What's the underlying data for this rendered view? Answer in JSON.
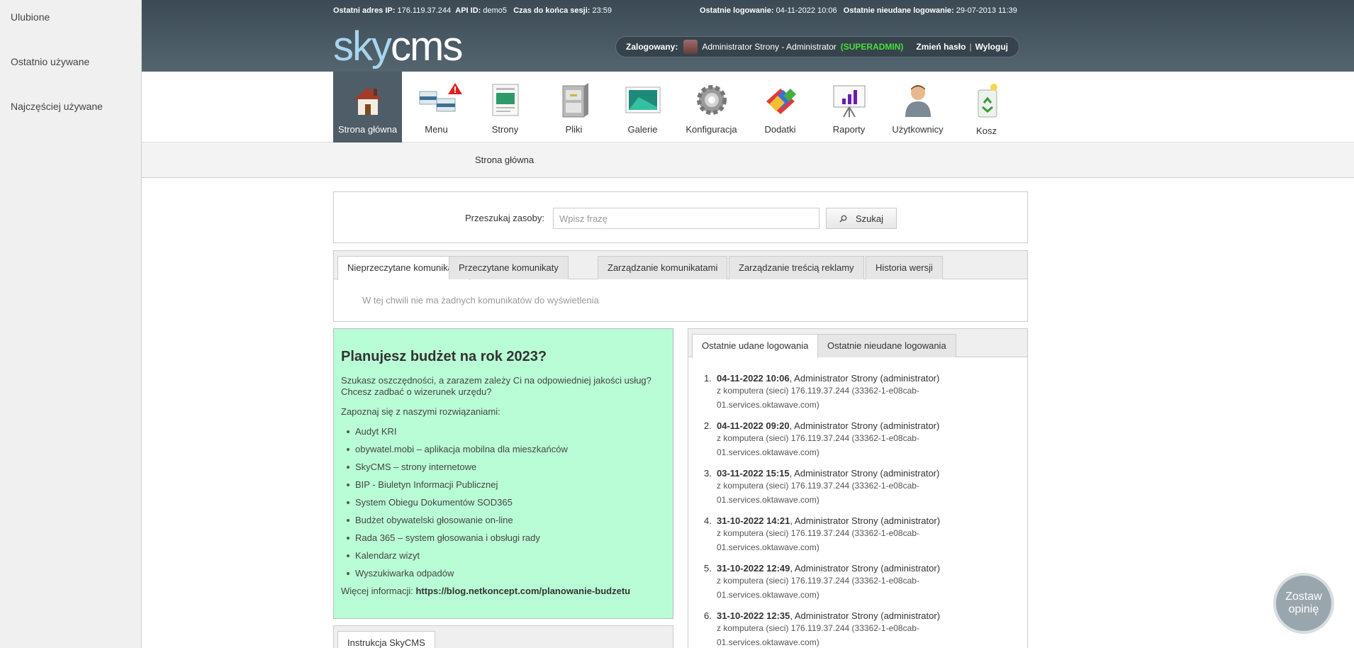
{
  "sidebar": {
    "items": [
      {
        "label": "Ulubione"
      },
      {
        "label": "Ostatnio używane"
      },
      {
        "label": "Najczęściej używane"
      }
    ]
  },
  "info": {
    "ip_label": "Ostatni adres IP:",
    "ip": "176.119.37.244",
    "api_label": "API ID:",
    "api": "demo5",
    "session_label": "Czas do końca sesji:",
    "session": "23:59",
    "last_login_label": "Ostatnie logowanie:",
    "last_login": "04-11-2022 10:06",
    "last_failed_label": "Ostatnie nieudane logowanie:",
    "last_failed": "29-07-2013 11:39"
  },
  "logo": {
    "sky": "sky",
    "cms": "cms"
  },
  "user": {
    "logged_label": "Zalogowany:",
    "name": "Administrator Strony",
    "role_text": "- Administrator",
    "role_badge": "(SUPERADMIN)",
    "change_password": "Zmień hasło",
    "logout": "Wyloguj"
  },
  "nav": [
    {
      "label": "Strona główna",
      "icon": "home-icon"
    },
    {
      "label": "Menu",
      "icon": "menu-icon"
    },
    {
      "label": "Strony",
      "icon": "pages-icon"
    },
    {
      "label": "Pliki",
      "icon": "files-icon"
    },
    {
      "label": "Galerie",
      "icon": "gallery-icon"
    },
    {
      "label": "Konfiguracja",
      "icon": "gear-icon"
    },
    {
      "label": "Dodatki",
      "icon": "addons-icon"
    },
    {
      "label": "Raporty",
      "icon": "reports-icon"
    },
    {
      "label": "Użytkownicy",
      "icon": "user-icon"
    },
    {
      "label": "Kosz",
      "icon": "trash-icon"
    }
  ],
  "breadcrumb": "Strona główna",
  "search": {
    "label": "Przeszukaj zasoby:",
    "placeholder": "Wpisz frazę",
    "button": "Szukaj"
  },
  "messages": {
    "tabs": [
      "Nieprzeczytane komunikaty",
      "Przeczytane komunikaty",
      "Zarządzanie komunikatami",
      "Zarządzanie treścią reklamy",
      "Historia wersji"
    ],
    "empty": "W tej chwili nie ma żadnych komunikatów do wyświetlenia"
  },
  "promo": {
    "title": "Planujesz budżet na rok 2023?",
    "p1": "Szukasz oszczędności, a zarazem zależy Ci na odpowiedniej jakości usług? Chcesz zadbać o wizerunek urzędu?",
    "p2": "Zapoznaj się z naszymi rozwiązaniami:",
    "items": [
      "Audyt KRI",
      "obywatel.mobi – aplikacja mobilna dla mieszkańców",
      "SkyCMS – strony internetowe",
      "BIP - Biuletyn Informacji Publicznej",
      "System Obiegu Dokumentów SOD365",
      "Budżet obywatelski głosowanie on-line",
      "Rada 365 – system głosowania i obsługi rady",
      "Kalendarz wizyt",
      "Wyszukiwarka odpadów"
    ],
    "more_label": "Więcej informacji:",
    "more_link": "https://blog.netkoncept.com/planowanie-budzetu"
  },
  "instr_tab": "Instrukcja SkyCMS",
  "logins": {
    "tabs": [
      "Ostatnie udane logowania",
      "Ostatnie nieudane logowania"
    ],
    "items": [
      {
        "num": "1.",
        "ts": "04-11-2022 10:06",
        "who": ", Administrator Strony (administrator)",
        "sub": "z komputera (sieci) 176.119.37.244 (33362-1-e08cab-01.services.oktawave.com)"
      },
      {
        "num": "2.",
        "ts": "04-11-2022 09:20",
        "who": ", Administrator Strony (administrator)",
        "sub": "z komputera (sieci) 176.119.37.244 (33362-1-e08cab-01.services.oktawave.com)"
      },
      {
        "num": "3.",
        "ts": "03-11-2022 15:15",
        "who": ", Administrator Strony (administrator)",
        "sub": "z komputera (sieci) 176.119.37.244 (33362-1-e08cab-01.services.oktawave.com)"
      },
      {
        "num": "4.",
        "ts": "31-10-2022 14:21",
        "who": ", Administrator Strony (administrator)",
        "sub": "z komputera (sieci) 176.119.37.244 (33362-1-e08cab-01.services.oktawave.com)"
      },
      {
        "num": "5.",
        "ts": "31-10-2022 12:49",
        "who": ", Administrator Strony (administrator)",
        "sub": "z komputera (sieci) 176.119.37.244 (33362-1-e08cab-01.services.oktawave.com)"
      },
      {
        "num": "6.",
        "ts": "31-10-2022 12:35",
        "who": ", Administrator Strony (administrator)",
        "sub": "z komputera (sieci) 176.119.37.244 (33362-1-e08cab-01.services.oktawave.com)"
      }
    ]
  },
  "feedback": "Zostaw opinię",
  "colors": {
    "topbar": "#4b5b66",
    "promo_bg": "#b9fdd6",
    "superadmin": "#45e13b",
    "logo_sky": "#a8d4ef"
  }
}
